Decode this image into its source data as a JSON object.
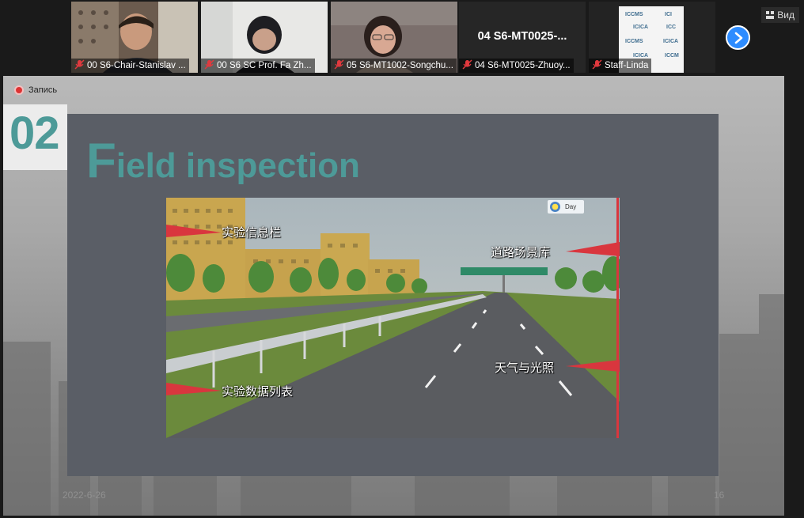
{
  "participants": [
    {
      "name": "00 S6-Chair-Stanislav ..."
    },
    {
      "name": "00 S6 SC Prof.  Fa Zh..."
    },
    {
      "name": "05 S6-MT1002-Songchu..."
    },
    {
      "name": "04 S6-MT0025-Zhuoy...",
      "big_label": "04 S6-MT0025-..."
    },
    {
      "name": "Staff-Linda",
      "logo_text": "ICICA ICCMS"
    }
  ],
  "toolbar": {
    "view_label": "Вид"
  },
  "recording": {
    "label": "Запись"
  },
  "slide": {
    "section_number": "02",
    "title_cap": "F",
    "title_rest": "ield inspection",
    "date": "2022-6-26",
    "page_number": "16",
    "annotations": {
      "top_left": "实验信息栏",
      "top_right": "道路场景库",
      "bottom_right": "天气与光照",
      "bottom_left": "实验数据列表"
    },
    "daymode": "Day"
  },
  "colors": {
    "accent_teal": "#4d9a98",
    "zoom_blue": "#2d8cff",
    "muted_red": "#d9363e"
  }
}
